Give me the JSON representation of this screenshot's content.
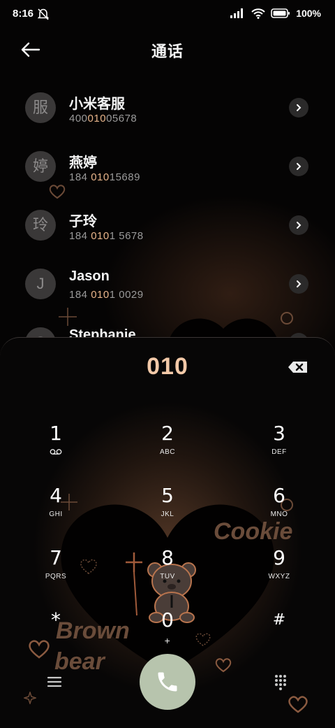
{
  "status_bar": {
    "time": "8:16",
    "battery": "100%"
  },
  "header": {
    "title": "通话"
  },
  "contacts": [
    {
      "avatar": "服",
      "name": "小米客服",
      "num_pre": "400",
      "num_hl": "010",
      "num_post": "05678"
    },
    {
      "avatar": "婷",
      "name": "燕婷",
      "num_pre": "184 ",
      "num_hl": "010",
      "num_post": "15689"
    },
    {
      "avatar": "玲",
      "name": "子玲",
      "num_pre": "184 ",
      "num_hl": "010",
      "num_post": "1 5678"
    },
    {
      "avatar": "J",
      "name": "Jason",
      "num_pre": "184 ",
      "num_hl": "010",
      "num_post": "1 0029"
    },
    {
      "avatar": "S",
      "name": "Stephanie",
      "num_pre": "",
      "num_hl": "",
      "num_post": ""
    }
  ],
  "dialer": {
    "entered": "010",
    "keys": [
      {
        "digit": "1",
        "letters": ""
      },
      {
        "digit": "2",
        "letters": "ABC"
      },
      {
        "digit": "3",
        "letters": "DEF"
      },
      {
        "digit": "4",
        "letters": "GHI"
      },
      {
        "digit": "5",
        "letters": "JKL"
      },
      {
        "digit": "6",
        "letters": "MNO"
      },
      {
        "digit": "7",
        "letters": "PQRS"
      },
      {
        "digit": "8",
        "letters": "TUV"
      },
      {
        "digit": "9",
        "letters": "WXYZ"
      },
      {
        "digit": "*",
        "letters": ""
      },
      {
        "digit": "0",
        "letters": "+"
      },
      {
        "digit": "#",
        "letters": ""
      }
    ]
  },
  "theme": {
    "cookie": "Cookie",
    "brown": "Brown",
    "bear": "bear",
    "accent": "#e8b48a",
    "call_button": "#b7c4ad"
  },
  "icons": [
    "back-arrow-icon",
    "chevron-right-icon",
    "backspace-icon",
    "voicemail-icon",
    "phone-icon",
    "menu-icon",
    "dialpad-icon",
    "silent-bell-icon",
    "signal-icon",
    "wifi-icon",
    "battery-icon"
  ]
}
